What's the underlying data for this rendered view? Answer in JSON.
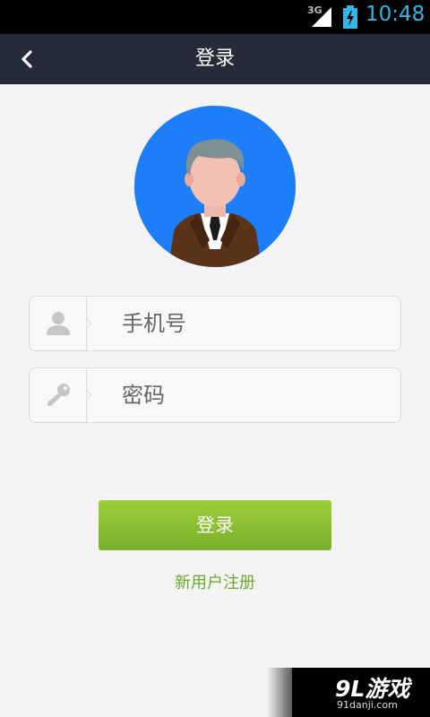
{
  "status_bar": {
    "network": "3G",
    "time": "10:48"
  },
  "header": {
    "title": "登录"
  },
  "form": {
    "phone_placeholder": "手机号",
    "password_placeholder": "密码",
    "login_label": "登录",
    "register_label": "新用户注册"
  },
  "watermark": {
    "brand": "9L游戏",
    "site": "91danji.com"
  },
  "colors": {
    "title_bar": "#252b38",
    "avatar_bg": "#1e7ef7",
    "login_button": "#8cc232",
    "register_link": "#6aa92c",
    "status_time": "#33b5e5"
  },
  "icons": [
    "back-arrow-icon",
    "signal-icon",
    "battery-icon",
    "user-icon",
    "key-icon"
  ]
}
